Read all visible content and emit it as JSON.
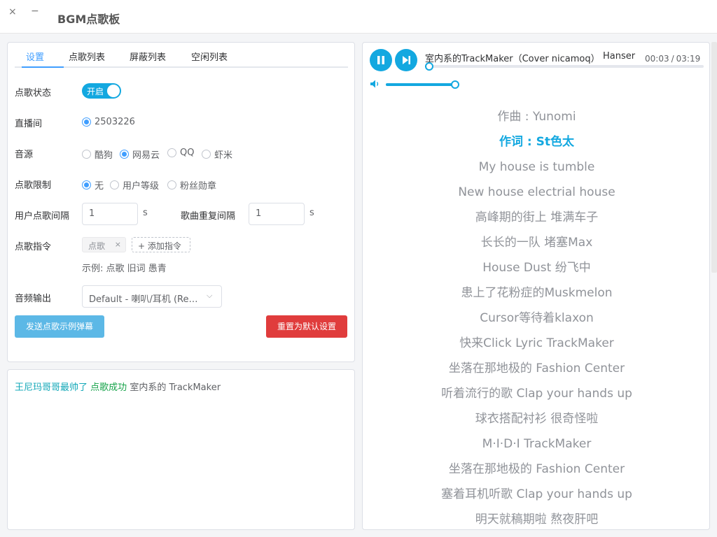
{
  "window": {
    "title": "BGM点歌板",
    "close_glyph": "×",
    "minimize_glyph": "−"
  },
  "tabs": [
    {
      "label": "设置",
      "active": true
    },
    {
      "label": "点歌列表",
      "active": false
    },
    {
      "label": "屏蔽列表",
      "active": false
    },
    {
      "label": "空闲列表",
      "active": false
    }
  ],
  "settings": {
    "status": {
      "label": "点歌状态",
      "toggle_text": "开启",
      "enabled": true
    },
    "room": {
      "label": "直播间",
      "option": "2503226",
      "checked": true
    },
    "source": {
      "label": "音源",
      "options": [
        {
          "label": "酷狗",
          "checked": false
        },
        {
          "label": "网易云",
          "checked": true
        },
        {
          "label": "QQ",
          "checked": false
        },
        {
          "label": "虾米",
          "checked": false
        }
      ]
    },
    "limit": {
      "label": "点歌限制",
      "options": [
        {
          "label": "无",
          "checked": true
        },
        {
          "label": "用户等级",
          "checked": false
        },
        {
          "label": "粉丝勋章",
          "checked": false
        }
      ]
    },
    "user_interval": {
      "label": "用户点歌间隔",
      "value": "1",
      "unit": "s"
    },
    "repeat_interval": {
      "label": "歌曲重复间隔",
      "value": "1",
      "unit": "s"
    },
    "command": {
      "label": "点歌指令",
      "tags": [
        "点歌"
      ],
      "tag_close_glyph": "×",
      "add_label": "添加指令",
      "add_glyph": "+",
      "example": "示例: 点歌 旧词 愚青"
    },
    "audio_output": {
      "label": "音频输出",
      "value": "Default - 喇叭/耳机 (Realtek High Definition Audio)",
      "arrow_glyph": "⌵"
    },
    "send_example_button": "发送点歌示例弹幕",
    "reset_button": "重置为默认设置"
  },
  "log": [
    {
      "user": "王尼玛哥哥最帅了",
      "action": "点歌成功",
      "song": "室内系的 TrackMaker"
    }
  ],
  "player": {
    "title": "室内系的TrackMaker（Cover nicamoq）",
    "artist": "Hanser",
    "current_time": "00:03",
    "time_sep": "/",
    "duration": "03:19",
    "progress": 0.015,
    "volume": 0.98,
    "icons": {
      "play_pause": "pause-icon",
      "next": "skip-next-icon",
      "volume": "volume-icon"
    },
    "accent": "#13a8e0"
  },
  "lyrics": [
    {
      "text": "作曲 : Yunomi",
      "current": false
    },
    {
      "text": "作词 : St色太",
      "current": true
    },
    {
      "text": "My house is tumble",
      "current": false
    },
    {
      "text": "New house electrial house",
      "current": false
    },
    {
      "text": "高峰期的街上 堆满车子",
      "current": false
    },
    {
      "text": "长长的一队 堵塞Max",
      "current": false
    },
    {
      "text": "House Dust 纷飞中",
      "current": false
    },
    {
      "text": "患上了花粉症的Muskmelon",
      "current": false
    },
    {
      "text": "Cursor等待着klaxon",
      "current": false
    },
    {
      "text": "快来Click Lyric TrackMaker",
      "current": false
    },
    {
      "text": "坐落在那地极的 Fashion Center",
      "current": false
    },
    {
      "text": "听着流行的歌 Clap your hands up",
      "current": false
    },
    {
      "text": "球衣搭配衬衫 很奇怪啦",
      "current": false
    },
    {
      "text": "M·I·D·I TrackMaker",
      "current": false
    },
    {
      "text": "坐落在那地极的 Fashion Center",
      "current": false
    },
    {
      "text": "塞着耳机听歌 Clap your hands up",
      "current": false
    },
    {
      "text": "明天就稿期啦 熬夜肝吧",
      "current": false
    }
  ]
}
